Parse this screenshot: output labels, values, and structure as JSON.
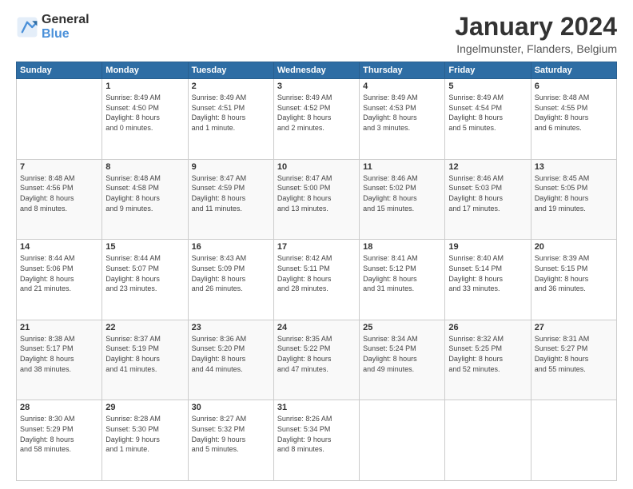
{
  "logo": {
    "line1": "General",
    "line2": "Blue"
  },
  "header": {
    "title": "January 2024",
    "subtitle": "Ingelmunster, Flanders, Belgium"
  },
  "days": [
    "Sunday",
    "Monday",
    "Tuesday",
    "Wednesday",
    "Thursday",
    "Friday",
    "Saturday"
  ],
  "weeks": [
    [
      {
        "day": "",
        "info": ""
      },
      {
        "day": "1",
        "info": "Sunrise: 8:49 AM\nSunset: 4:50 PM\nDaylight: 8 hours\nand 0 minutes."
      },
      {
        "day": "2",
        "info": "Sunrise: 8:49 AM\nSunset: 4:51 PM\nDaylight: 8 hours\nand 1 minute."
      },
      {
        "day": "3",
        "info": "Sunrise: 8:49 AM\nSunset: 4:52 PM\nDaylight: 8 hours\nand 2 minutes."
      },
      {
        "day": "4",
        "info": "Sunrise: 8:49 AM\nSunset: 4:53 PM\nDaylight: 8 hours\nand 3 minutes."
      },
      {
        "day": "5",
        "info": "Sunrise: 8:49 AM\nSunset: 4:54 PM\nDaylight: 8 hours\nand 5 minutes."
      },
      {
        "day": "6",
        "info": "Sunrise: 8:48 AM\nSunset: 4:55 PM\nDaylight: 8 hours\nand 6 minutes."
      }
    ],
    [
      {
        "day": "7",
        "info": "Sunrise: 8:48 AM\nSunset: 4:56 PM\nDaylight: 8 hours\nand 8 minutes."
      },
      {
        "day": "8",
        "info": "Sunrise: 8:48 AM\nSunset: 4:58 PM\nDaylight: 8 hours\nand 9 minutes."
      },
      {
        "day": "9",
        "info": "Sunrise: 8:47 AM\nSunset: 4:59 PM\nDaylight: 8 hours\nand 11 minutes."
      },
      {
        "day": "10",
        "info": "Sunrise: 8:47 AM\nSunset: 5:00 PM\nDaylight: 8 hours\nand 13 minutes."
      },
      {
        "day": "11",
        "info": "Sunrise: 8:46 AM\nSunset: 5:02 PM\nDaylight: 8 hours\nand 15 minutes."
      },
      {
        "day": "12",
        "info": "Sunrise: 8:46 AM\nSunset: 5:03 PM\nDaylight: 8 hours\nand 17 minutes."
      },
      {
        "day": "13",
        "info": "Sunrise: 8:45 AM\nSunset: 5:05 PM\nDaylight: 8 hours\nand 19 minutes."
      }
    ],
    [
      {
        "day": "14",
        "info": "Sunrise: 8:44 AM\nSunset: 5:06 PM\nDaylight: 8 hours\nand 21 minutes."
      },
      {
        "day": "15",
        "info": "Sunrise: 8:44 AM\nSunset: 5:07 PM\nDaylight: 8 hours\nand 23 minutes."
      },
      {
        "day": "16",
        "info": "Sunrise: 8:43 AM\nSunset: 5:09 PM\nDaylight: 8 hours\nand 26 minutes."
      },
      {
        "day": "17",
        "info": "Sunrise: 8:42 AM\nSunset: 5:11 PM\nDaylight: 8 hours\nand 28 minutes."
      },
      {
        "day": "18",
        "info": "Sunrise: 8:41 AM\nSunset: 5:12 PM\nDaylight: 8 hours\nand 31 minutes."
      },
      {
        "day": "19",
        "info": "Sunrise: 8:40 AM\nSunset: 5:14 PM\nDaylight: 8 hours\nand 33 minutes."
      },
      {
        "day": "20",
        "info": "Sunrise: 8:39 AM\nSunset: 5:15 PM\nDaylight: 8 hours\nand 36 minutes."
      }
    ],
    [
      {
        "day": "21",
        "info": "Sunrise: 8:38 AM\nSunset: 5:17 PM\nDaylight: 8 hours\nand 38 minutes."
      },
      {
        "day": "22",
        "info": "Sunrise: 8:37 AM\nSunset: 5:19 PM\nDaylight: 8 hours\nand 41 minutes."
      },
      {
        "day": "23",
        "info": "Sunrise: 8:36 AM\nSunset: 5:20 PM\nDaylight: 8 hours\nand 44 minutes."
      },
      {
        "day": "24",
        "info": "Sunrise: 8:35 AM\nSunset: 5:22 PM\nDaylight: 8 hours\nand 47 minutes."
      },
      {
        "day": "25",
        "info": "Sunrise: 8:34 AM\nSunset: 5:24 PM\nDaylight: 8 hours\nand 49 minutes."
      },
      {
        "day": "26",
        "info": "Sunrise: 8:32 AM\nSunset: 5:25 PM\nDaylight: 8 hours\nand 52 minutes."
      },
      {
        "day": "27",
        "info": "Sunrise: 8:31 AM\nSunset: 5:27 PM\nDaylight: 8 hours\nand 55 minutes."
      }
    ],
    [
      {
        "day": "28",
        "info": "Sunrise: 8:30 AM\nSunset: 5:29 PM\nDaylight: 8 hours\nand 58 minutes."
      },
      {
        "day": "29",
        "info": "Sunrise: 8:28 AM\nSunset: 5:30 PM\nDaylight: 9 hours\nand 1 minute."
      },
      {
        "day": "30",
        "info": "Sunrise: 8:27 AM\nSunset: 5:32 PM\nDaylight: 9 hours\nand 5 minutes."
      },
      {
        "day": "31",
        "info": "Sunrise: 8:26 AM\nSunset: 5:34 PM\nDaylight: 9 hours\nand 8 minutes."
      },
      {
        "day": "",
        "info": ""
      },
      {
        "day": "",
        "info": ""
      },
      {
        "day": "",
        "info": ""
      }
    ]
  ]
}
